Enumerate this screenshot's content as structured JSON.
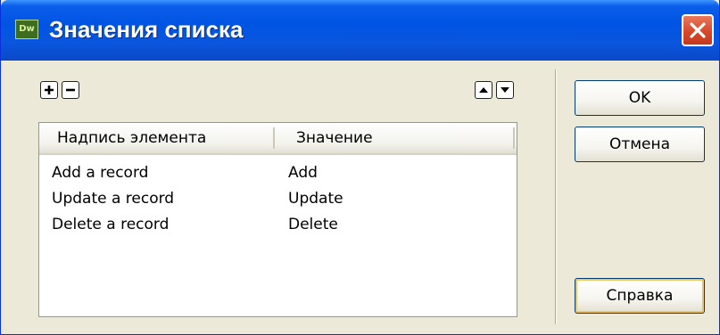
{
  "window": {
    "title": "Значения списка",
    "app_icon_text": "Dw"
  },
  "toolbar": {
    "add_icon": "plus-icon",
    "remove_icon": "minus-icon",
    "move_up_icon": "arrow-up-icon",
    "move_down_icon": "arrow-down-icon"
  },
  "list": {
    "columns": [
      "Надпись элемента",
      "Значение"
    ],
    "rows": [
      {
        "label": "Add a record",
        "value": "Add"
      },
      {
        "label": "Update a record",
        "value": "Update"
      },
      {
        "label": "Delete a record",
        "value": "Delete"
      }
    ]
  },
  "buttons": {
    "ok": "OK",
    "cancel": "Отмена",
    "help": "Справка"
  },
  "colors": {
    "titlebar": "#0054e3",
    "close_button": "#d8482b",
    "dialog_background": "#ece9d8",
    "list_border": "#7f9db9"
  }
}
